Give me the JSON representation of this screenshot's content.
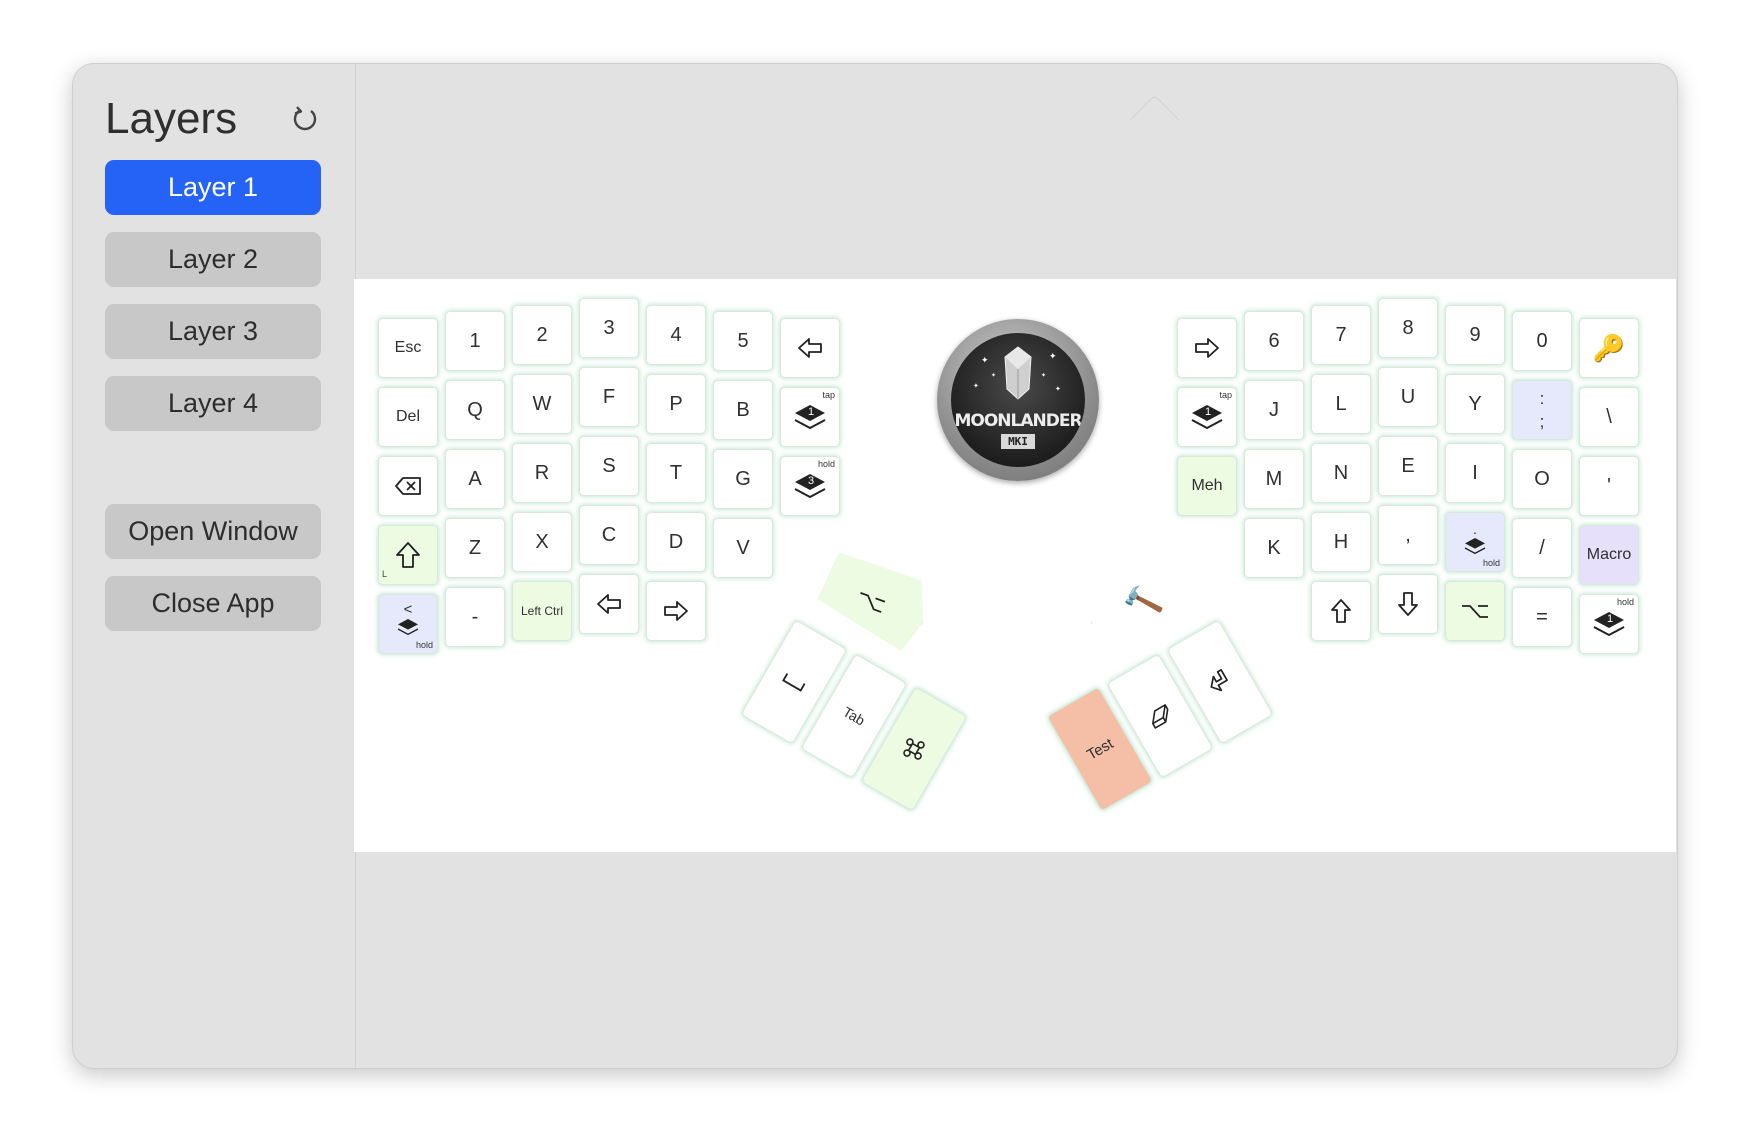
{
  "sidebar": {
    "title": "Layers",
    "layers": [
      "Layer 1",
      "Layer 2",
      "Layer 3",
      "Layer 4"
    ],
    "active_layer": "Layer 1",
    "open_window": "Open Window",
    "close_app": "Close App"
  },
  "keyboard": {
    "logo_text": "MOONLANDER",
    "logo_sub": "MKI",
    "left": {
      "row0": [
        "Esc",
        "1",
        "2",
        "3",
        "4",
        "5"
      ],
      "row1": [
        "Del",
        "Q",
        "W",
        "F",
        "P",
        "B"
      ],
      "row2": [
        "A",
        "R",
        "S",
        "T",
        "G"
      ],
      "row3": [
        "Z",
        "X",
        "C",
        "D",
        "V"
      ],
      "row4_minus": "-",
      "left_ctrl": "Left Ctrl",
      "layer_tap_num": "1",
      "layer_hold_num": "3",
      "bottom_lt_top": "<",
      "bottom_lt_num": "1",
      "tap": "tap",
      "hold": "hold",
      "tab": "Tab"
    },
    "right": {
      "row0": [
        "6",
        "7",
        "8",
        "9",
        "0"
      ],
      "row1": [
        "J",
        "L",
        "U",
        "Y"
      ],
      "semicolon_top": ":",
      "semicolon_bottom": ";",
      "backslash": "\\",
      "meh": "Meh",
      "row2": [
        "M",
        "N",
        "E",
        "I",
        "O"
      ],
      "quote": "'",
      "row3": [
        "K",
        "H",
        ","
      ],
      "dot_key_top": ".",
      "dot_key_num": "2",
      "slash": "/",
      "macro": "Macro",
      "equals": "=",
      "layer_tap_num": "1",
      "layer_hold_num": "1",
      "tap": "tap",
      "hold": "hold",
      "test": "Test"
    }
  }
}
